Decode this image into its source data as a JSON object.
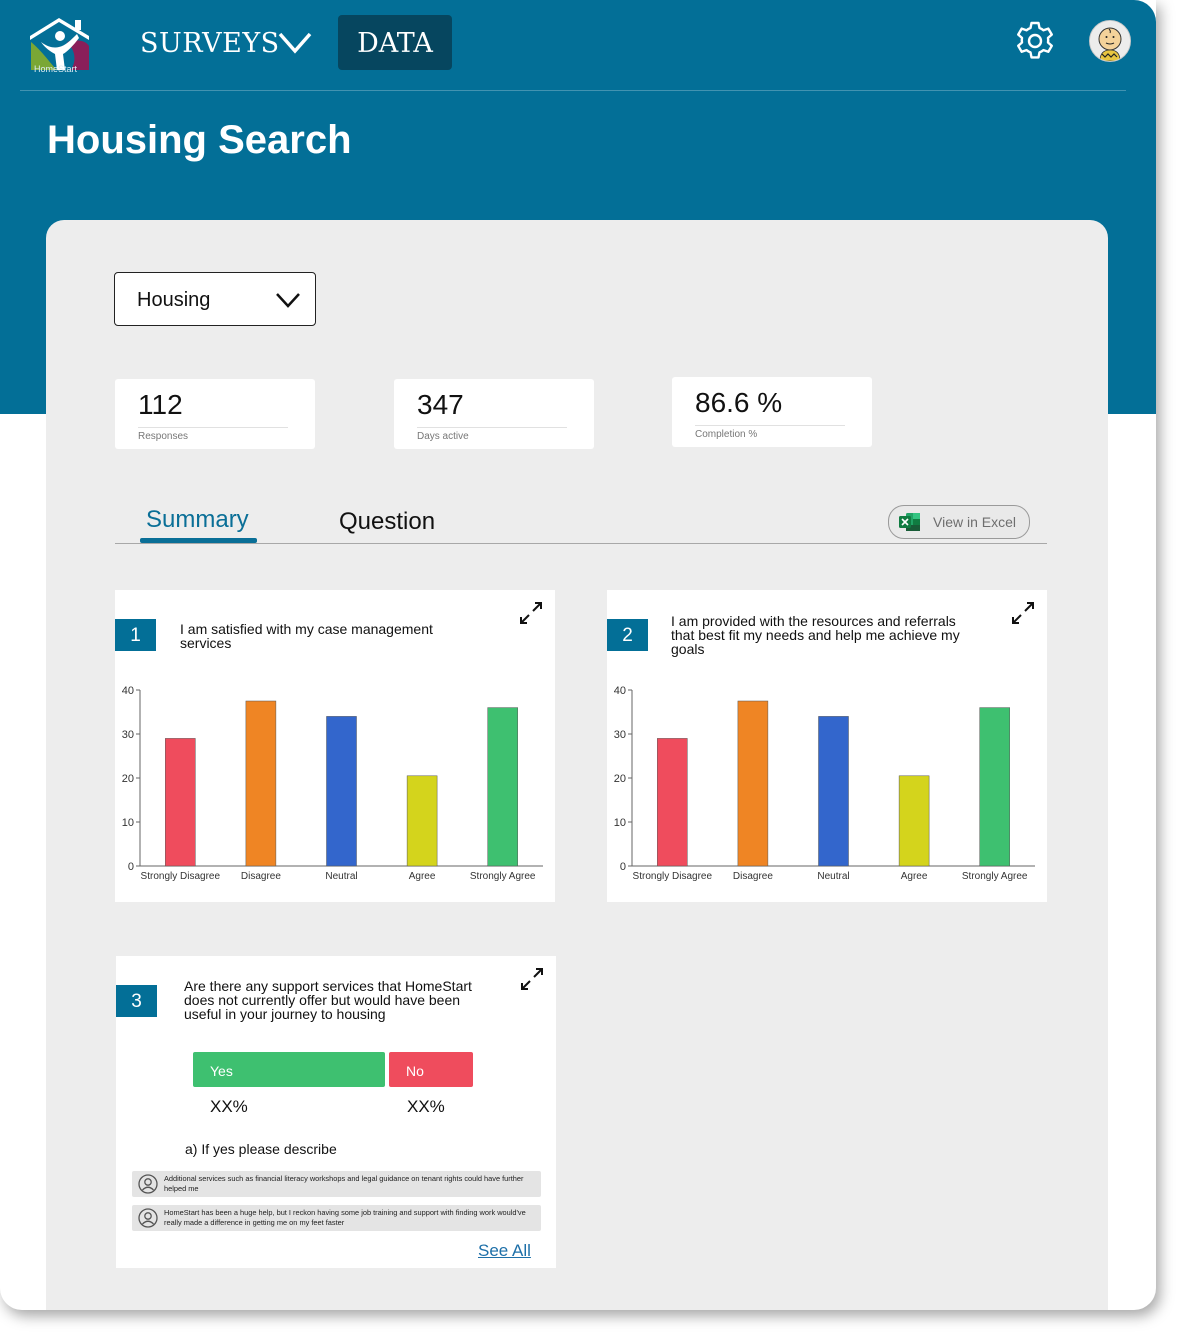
{
  "header": {
    "logo_text": "HomeStart",
    "nav_surveys": "SURVEYS",
    "nav_data": "DATA",
    "icons": [
      "chevron-down-icon",
      "gear-icon",
      "avatar"
    ]
  },
  "page": {
    "title": "Housing Search"
  },
  "filter": {
    "selected": "Housing"
  },
  "stats": [
    {
      "value": "112",
      "label": "Responses"
    },
    {
      "value": "347",
      "label": "Days active"
    },
    {
      "value": "86.6 %",
      "label": "Completion %"
    }
  ],
  "tabs": {
    "summary": "Summary",
    "question": "Question",
    "excel": "View in Excel"
  },
  "colors": {
    "brand": "#036f97",
    "nav_active": "#06465f",
    "panel": "#ededed"
  },
  "questions": [
    {
      "number": "1",
      "text": "I am satisfied with my case management services"
    },
    {
      "number": "2",
      "text": "I am provided with the resources and referrals that best fit my needs and help me achieve my goals"
    },
    {
      "number": "3",
      "text": "Are there any support services that HomeStart does not currently offer but would have been useful in your journey to housing"
    }
  ],
  "chart_data": [
    {
      "type": "bar",
      "categories": [
        "Strongly Disagree",
        "Disagree",
        "Neutral",
        "Agree",
        "Strongly Agree"
      ],
      "values": [
        29,
        37.5,
        34,
        20.5,
        36
      ],
      "colors": [
        "#ef4c5d",
        "#ef8524",
        "#3366cc",
        "#d4d41c",
        "#3ec070"
      ],
      "ylim": [
        0,
        40
      ],
      "yticks": [
        0,
        10,
        20,
        30,
        40
      ],
      "grid": false
    },
    {
      "type": "bar",
      "categories": [
        "Strongly Disagree",
        "Disagree",
        "Neutral",
        "Agree",
        "Strongly Agree"
      ],
      "values": [
        29,
        37.5,
        34,
        20.5,
        36
      ],
      "colors": [
        "#ef4c5d",
        "#ef8524",
        "#3366cc",
        "#d4d41c",
        "#3ec070"
      ],
      "ylim": [
        0,
        40
      ],
      "yticks": [
        0,
        10,
        20,
        30,
        40
      ],
      "grid": false
    }
  ],
  "q3": {
    "yes_label": "Yes",
    "no_label": "No",
    "yes_pct": "XX%",
    "no_pct": "XX%",
    "sub_question": "a) If yes please describe",
    "responses": [
      "Additional services such as financial literacy workshops and legal guidance on tenant rights could have further helped me",
      "HomeStart has been a huge help, but I reckon having some job training and support with finding work would've really made a difference in getting me on my feet faster"
    ],
    "see_all": "See All"
  }
}
